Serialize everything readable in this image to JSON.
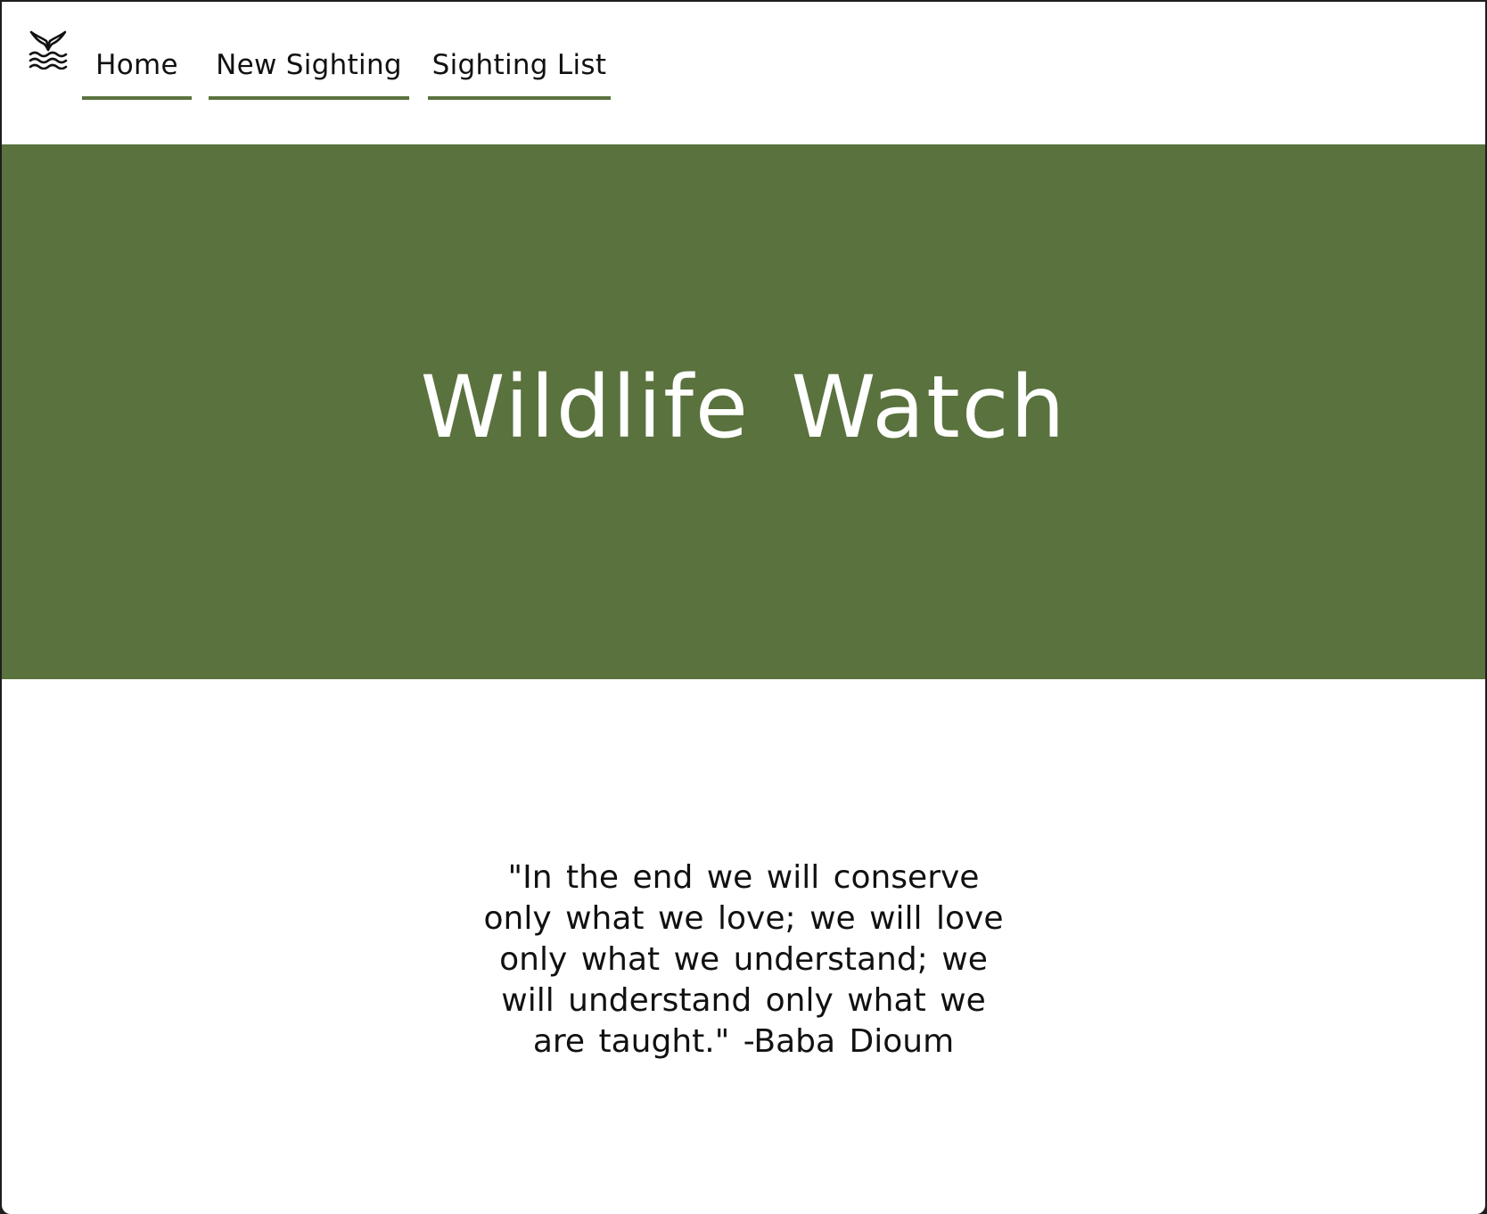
{
  "nav": {
    "logo_icon": "whale-tail-waves-icon",
    "items": [
      {
        "label": "Home"
      },
      {
        "label": "New Sighting"
      },
      {
        "label": "Sighting List"
      }
    ]
  },
  "hero": {
    "title": "Wildlife Watch"
  },
  "quote": {
    "text": "\"In the end we will conserve only what we love; we will love only what we understand; we will understand only what we are taught.\" -Baba Dioum"
  },
  "colors": {
    "accent": "#5a723e",
    "background": "#ffffff",
    "text": "#111111"
  }
}
